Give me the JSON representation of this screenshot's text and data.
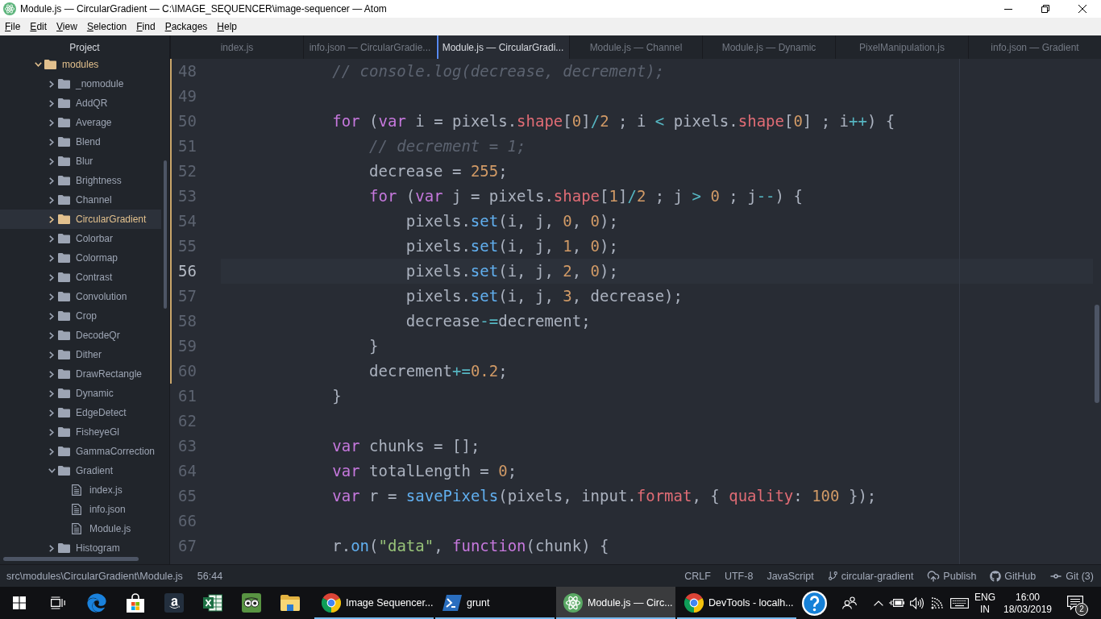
{
  "window": {
    "title": "Module.js — CircularGradient — C:\\IMAGE_SEQUENCER\\image-sequencer — Atom"
  },
  "menu": [
    "File",
    "Edit",
    "View",
    "Selection",
    "Find",
    "Packages",
    "Help"
  ],
  "sidebar": {
    "title": "Project",
    "tree": [
      {
        "kind": "folder",
        "label": "modules",
        "expanded": true,
        "selected": false,
        "modified": true,
        "children": [
          {
            "kind": "folder",
            "label": "_nomodule",
            "expanded": false,
            "selected": false,
            "modified": false
          },
          {
            "kind": "folder",
            "label": "AddQR",
            "expanded": false,
            "selected": false,
            "modified": false
          },
          {
            "kind": "folder",
            "label": "Average",
            "expanded": false,
            "selected": false,
            "modified": false
          },
          {
            "kind": "folder",
            "label": "Blend",
            "expanded": false,
            "selected": false,
            "modified": false
          },
          {
            "kind": "folder",
            "label": "Blur",
            "expanded": false,
            "selected": false,
            "modified": false
          },
          {
            "kind": "folder",
            "label": "Brightness",
            "expanded": false,
            "selected": false,
            "modified": false
          },
          {
            "kind": "folder",
            "label": "Channel",
            "expanded": false,
            "selected": false,
            "modified": false
          },
          {
            "kind": "folder",
            "label": "CircularGradient",
            "expanded": false,
            "selected": true,
            "modified": true
          },
          {
            "kind": "folder",
            "label": "Colorbar",
            "expanded": false,
            "selected": false,
            "modified": false
          },
          {
            "kind": "folder",
            "label": "Colormap",
            "expanded": false,
            "selected": false,
            "modified": false
          },
          {
            "kind": "folder",
            "label": "Contrast",
            "expanded": false,
            "selected": false,
            "modified": false
          },
          {
            "kind": "folder",
            "label": "Convolution",
            "expanded": false,
            "selected": false,
            "modified": false
          },
          {
            "kind": "folder",
            "label": "Crop",
            "expanded": false,
            "selected": false,
            "modified": false
          },
          {
            "kind": "folder",
            "label": "DecodeQr",
            "expanded": false,
            "selected": false,
            "modified": false
          },
          {
            "kind": "folder",
            "label": "Dither",
            "expanded": false,
            "selected": false,
            "modified": false
          },
          {
            "kind": "folder",
            "label": "DrawRectangle",
            "expanded": false,
            "selected": false,
            "modified": false
          },
          {
            "kind": "folder",
            "label": "Dynamic",
            "expanded": false,
            "selected": false,
            "modified": false
          },
          {
            "kind": "folder",
            "label": "EdgeDetect",
            "expanded": false,
            "selected": false,
            "modified": false
          },
          {
            "kind": "folder",
            "label": "FisheyeGl",
            "expanded": false,
            "selected": false,
            "modified": false
          },
          {
            "kind": "folder",
            "label": "GammaCorrection",
            "expanded": false,
            "selected": false,
            "modified": false
          },
          {
            "kind": "folder",
            "label": "Gradient",
            "expanded": true,
            "selected": false,
            "modified": false,
            "children": [
              {
                "kind": "file",
                "label": "index.js",
                "selected": false,
                "modified": false
              },
              {
                "kind": "file",
                "label": "info.json",
                "selected": false,
                "modified": false
              },
              {
                "kind": "file",
                "label": "Module.js",
                "selected": false,
                "modified": false
              }
            ]
          },
          {
            "kind": "folder",
            "label": "Histogram",
            "expanded": false,
            "selected": false,
            "modified": false
          }
        ]
      }
    ]
  },
  "tabs": [
    {
      "label": "index.js",
      "selected": false
    },
    {
      "label": "info.json — CircularGradie...",
      "selected": false
    },
    {
      "label": "Module.js — CircularGradi...",
      "selected": true
    },
    {
      "label": "Module.js — Channel",
      "selected": false
    },
    {
      "label": "Module.js — Dynamic",
      "selected": false
    },
    {
      "label": "PixelManipulation.js",
      "selected": false
    },
    {
      "label": "info.json — Gradient",
      "selected": false
    }
  ],
  "editor": {
    "lines": [
      {
        "number": "48",
        "current": false,
        "modified": true,
        "tokens": [
          {
            "kind": "comment",
            "text": "            // console.log(decrease, decrement);"
          }
        ]
      },
      {
        "number": "49",
        "current": false,
        "modified": true
      },
      {
        "number": "50",
        "current": false,
        "modified": true,
        "tokens": [
          {
            "kind": "keyword",
            "text": "            for"
          },
          {
            "kind": "plain",
            "text": " ("
          },
          {
            "kind": "keyword",
            "text": "var"
          },
          {
            "kind": "plain",
            "text": " i = pixels."
          },
          {
            "kind": "property",
            "text": "shape"
          },
          {
            "kind": "plain",
            "text": "["
          },
          {
            "kind": "number",
            "text": "0"
          },
          {
            "kind": "plain",
            "text": "]"
          },
          {
            "kind": "operator",
            "text": "/"
          },
          {
            "kind": "number",
            "text": "2"
          },
          {
            "kind": "plain",
            "text": " ; i "
          },
          {
            "kind": "operator",
            "text": "<"
          },
          {
            "kind": "plain",
            "text": " pixels."
          },
          {
            "kind": "property",
            "text": "shape"
          },
          {
            "kind": "plain",
            "text": "["
          },
          {
            "kind": "number",
            "text": "0"
          },
          {
            "kind": "plain",
            "text": "] ; i"
          },
          {
            "kind": "operator",
            "text": "++"
          },
          {
            "kind": "plain",
            "text": ") {"
          }
        ]
      },
      {
        "number": "51",
        "current": false,
        "modified": true,
        "tokens": [
          {
            "kind": "comment",
            "text": "                // decrement = 1;"
          }
        ]
      },
      {
        "number": "52",
        "current": false,
        "modified": true,
        "tokens": [
          {
            "kind": "plain",
            "text": "                decrease = "
          },
          {
            "kind": "number",
            "text": "255"
          },
          {
            "kind": "plain",
            "text": ";"
          }
        ]
      },
      {
        "number": "53",
        "current": false,
        "modified": true,
        "tokens": [
          {
            "kind": "keyword",
            "text": "                for"
          },
          {
            "kind": "plain",
            "text": " ("
          },
          {
            "kind": "keyword",
            "text": "var"
          },
          {
            "kind": "plain",
            "text": " j = pixels."
          },
          {
            "kind": "property",
            "text": "shape"
          },
          {
            "kind": "plain",
            "text": "["
          },
          {
            "kind": "number",
            "text": "1"
          },
          {
            "kind": "plain",
            "text": "]"
          },
          {
            "kind": "operator",
            "text": "/"
          },
          {
            "kind": "number",
            "text": "2"
          },
          {
            "kind": "plain",
            "text": " ; j "
          },
          {
            "kind": "operator",
            "text": ">"
          },
          {
            "kind": "number",
            "text": " 0"
          },
          {
            "kind": "plain",
            "text": " ; j"
          },
          {
            "kind": "operator",
            "text": "--"
          },
          {
            "kind": "plain",
            "text": ") {"
          }
        ]
      },
      {
        "number": "54",
        "current": false,
        "modified": true,
        "tokens": [
          {
            "kind": "plain",
            "text": "                    pixels."
          },
          {
            "kind": "function",
            "text": "set"
          },
          {
            "kind": "plain",
            "text": "(i, j, "
          },
          {
            "kind": "number",
            "text": "0"
          },
          {
            "kind": "plain",
            "text": ", "
          },
          {
            "kind": "number",
            "text": "0"
          },
          {
            "kind": "plain",
            "text": ");"
          }
        ]
      },
      {
        "number": "55",
        "current": false,
        "modified": true,
        "tokens": [
          {
            "kind": "plain",
            "text": "                    pixels."
          },
          {
            "kind": "function",
            "text": "set"
          },
          {
            "kind": "plain",
            "text": "(i, j, "
          },
          {
            "kind": "number",
            "text": "1"
          },
          {
            "kind": "plain",
            "text": ", "
          },
          {
            "kind": "number",
            "text": "0"
          },
          {
            "kind": "plain",
            "text": ");"
          }
        ]
      },
      {
        "number": "56",
        "current": true,
        "modified": true,
        "tokens": [
          {
            "kind": "plain",
            "text": "                    pixels."
          },
          {
            "kind": "function",
            "text": "set"
          },
          {
            "kind": "plain",
            "text": "(i, j, "
          },
          {
            "kind": "number",
            "text": "2"
          },
          {
            "kind": "plain",
            "text": ", "
          },
          {
            "kind": "number",
            "text": "0"
          },
          {
            "kind": "plain",
            "text": ");"
          }
        ]
      },
      {
        "number": "57",
        "current": false,
        "modified": true,
        "tokens": [
          {
            "kind": "plain",
            "text": "                    pixels."
          },
          {
            "kind": "function",
            "text": "set"
          },
          {
            "kind": "plain",
            "text": "(i, j, "
          },
          {
            "kind": "number",
            "text": "3"
          },
          {
            "kind": "plain",
            "text": ", decrease);"
          }
        ]
      },
      {
        "number": "58",
        "current": false,
        "modified": true,
        "tokens": [
          {
            "kind": "plain",
            "text": "                    decrease"
          },
          {
            "kind": "operator",
            "text": "-="
          },
          {
            "kind": "plain",
            "text": "decrement;"
          }
        ]
      },
      {
        "number": "59",
        "current": false,
        "modified": true,
        "tokens": [
          {
            "kind": "plain",
            "text": "                }"
          }
        ]
      },
      {
        "number": "60",
        "current": false,
        "modified": true,
        "tokens": [
          {
            "kind": "plain",
            "text": "                decrement"
          },
          {
            "kind": "operator",
            "text": "+="
          },
          {
            "kind": "number",
            "text": "0.2"
          },
          {
            "kind": "plain",
            "text": ";"
          }
        ]
      },
      {
        "number": "61",
        "current": false,
        "modified": false,
        "tokens": [
          {
            "kind": "plain",
            "text": "            }"
          }
        ]
      },
      {
        "number": "62",
        "current": false,
        "modified": false
      },
      {
        "number": "63",
        "current": false,
        "modified": false,
        "tokens": [
          {
            "kind": "keyword",
            "text": "            var"
          },
          {
            "kind": "plain",
            "text": " chunks = [];"
          }
        ]
      },
      {
        "number": "64",
        "current": false,
        "modified": false,
        "tokens": [
          {
            "kind": "keyword",
            "text": "            var"
          },
          {
            "kind": "plain",
            "text": " totalLength = "
          },
          {
            "kind": "number",
            "text": "0"
          },
          {
            "kind": "plain",
            "text": ";"
          }
        ]
      },
      {
        "number": "65",
        "current": false,
        "modified": false,
        "tokens": [
          {
            "kind": "keyword",
            "text": "            var"
          },
          {
            "kind": "plain",
            "text": " r = "
          },
          {
            "kind": "function",
            "text": "savePixels"
          },
          {
            "kind": "plain",
            "text": "(pixels, input."
          },
          {
            "kind": "property",
            "text": "format"
          },
          {
            "kind": "plain",
            "text": ", { "
          },
          {
            "kind": "property",
            "text": "quality"
          },
          {
            "kind": "plain",
            "text": ": "
          },
          {
            "kind": "number",
            "text": "100"
          },
          {
            "kind": "plain",
            "text": " });"
          }
        ]
      },
      {
        "number": "66",
        "current": false,
        "modified": false
      },
      {
        "number": "67",
        "current": false,
        "modified": false,
        "tokens": [
          {
            "kind": "plain",
            "text": "            r."
          },
          {
            "kind": "function",
            "text": "on"
          },
          {
            "kind": "plain",
            "text": "("
          },
          {
            "kind": "string",
            "text": "\"data\""
          },
          {
            "kind": "plain",
            "text": ", "
          },
          {
            "kind": "keyword",
            "text": "function"
          },
          {
            "kind": "plain",
            "text": "(chunk) {"
          }
        ]
      }
    ]
  },
  "status_bar": {
    "path": "src\\modules\\CircularGradient\\Module.js",
    "cursor": "56:44",
    "items": [
      {
        "kind": "line_ending",
        "label": "CRLF"
      },
      {
        "kind": "encoding",
        "label": "UTF-8"
      },
      {
        "kind": "grammar",
        "label": "JavaScript"
      },
      {
        "kind": "branch",
        "label": "circular-gradient"
      },
      {
        "kind": "publish",
        "label": "Publish"
      },
      {
        "kind": "github",
        "label": "GitHub"
      },
      {
        "kind": "git",
        "label": "Git (3)"
      }
    ]
  },
  "taskbar": {
    "windows": [
      {
        "kind": "browser",
        "label": "Image Sequencer...",
        "selected": false
      },
      {
        "kind": "terminal",
        "label": "grunt",
        "selected": false
      },
      {
        "kind": "editor",
        "label": "Module.js — Circ...",
        "selected": true
      },
      {
        "kind": "browser",
        "label": "DevTools - localh...",
        "selected": false
      }
    ],
    "language": "ENG",
    "region": "IN",
    "time": "16:00",
    "date": "18/03/2019",
    "notifications": "2"
  }
}
